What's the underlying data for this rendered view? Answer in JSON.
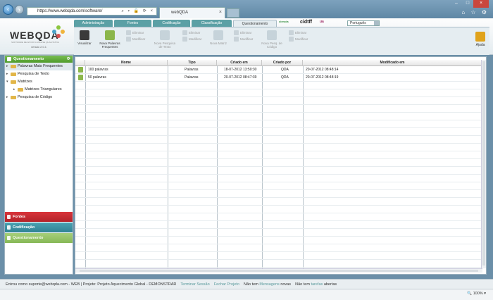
{
  "browser": {
    "url": "https://www.webqda.com/software/",
    "tab_title": "webQDA",
    "back_icon": "back-arrow-icon",
    "forward_icon": "forward-arrow-icon"
  },
  "app": {
    "logo_text": "WEBQDA",
    "logo_subtitle": "SOFTWARE DE APOIO À ANÁLISE QUALITATIVA",
    "logo_version": "versão 2.0.1",
    "ribbon_tabs": [
      "Administração",
      "Fontes",
      "Codificação",
      "Classificação",
      "Questionamento"
    ],
    "active_tab": "Questionamento",
    "partners": [
      "ciencia",
      "cidtff",
      "ua"
    ],
    "language": "Português",
    "ribbon": {
      "visualizar": "Visualizar",
      "nova_palavras": "Nova Palavras Frequentes",
      "eliminar": "Eliminar",
      "modificar": "Modificar",
      "nova_pesquisa": "Nova Pesquisa de Texto",
      "nova_matriz": "Nova Matriz",
      "nova_pesq_codigo": "Nova Pesq. de Código",
      "ajuda": "Ajuda"
    }
  },
  "sidebar": {
    "header": "Questionamento",
    "items": [
      {
        "label": "Palavras Mais Frequentes",
        "level": 0,
        "selected": true
      },
      {
        "label": "Pesquisa de Texto",
        "level": 0,
        "selected": false
      },
      {
        "label": "Matrizes",
        "level": 0,
        "selected": false,
        "expanded": true
      },
      {
        "label": "Matrizes Triangulares",
        "level": 1,
        "selected": false
      },
      {
        "label": "Pesquisa de Código",
        "level": 0,
        "selected": false
      }
    ],
    "accordion": {
      "fontes": "Fontes",
      "codificacao": "Codificação",
      "questionamento": "Questionamento"
    }
  },
  "grid": {
    "columns": [
      "Nome",
      "Tipo",
      "Criado em",
      "Criado por",
      "Modificado em"
    ],
    "rows": [
      {
        "nome": "100 palavras",
        "tipo": "Palavras",
        "criado_em": "18-07-2012 13:50:30",
        "criado_por": "QDA",
        "modificado_em": "20-07-2012 08:48:14"
      },
      {
        "nome": "50 palavras",
        "tipo": "Palavras",
        "criado_em": "20-07-2012 08:47:39",
        "criado_por": "QDA",
        "modificado_em": "20-07-2012 08:48:19"
      }
    ]
  },
  "status": {
    "prefix": "Entrou como suporte@webqda.com - WEB | Projeto: Projeto Aquecimento Global - DEMONSTRAR",
    "terminar": "Terminar Sessão",
    "fechar": "Fechar Projeto",
    "msg1": "Não tem",
    "mensagens": "Mensagens",
    "novas": "novas",
    "msg2": "Não tem",
    "tarefas": "tarefas",
    "abertas": "abertas"
  },
  "zoom": "100%",
  "colors": {
    "accent_green": "#4e9a2b",
    "fontes_red": "#c0272d",
    "codificacao_teal": "#3a8fa0",
    "questionamento_green": "#8fbf5e"
  }
}
